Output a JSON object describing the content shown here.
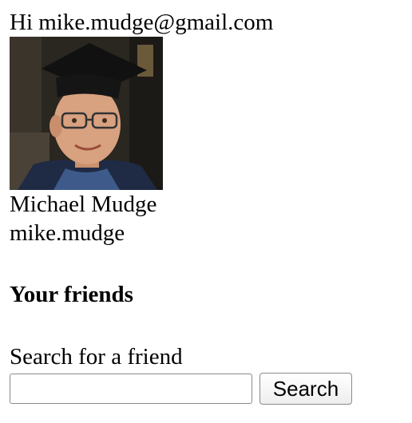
{
  "greeting": "Hi mike.mudge@gmail.com",
  "profile": {
    "full_name": "Michael Mudge",
    "username": "mike.mudge"
  },
  "friends": {
    "heading": "Your friends"
  },
  "search": {
    "label": "Search for a friend",
    "input_value": "",
    "button_label": "Search"
  }
}
